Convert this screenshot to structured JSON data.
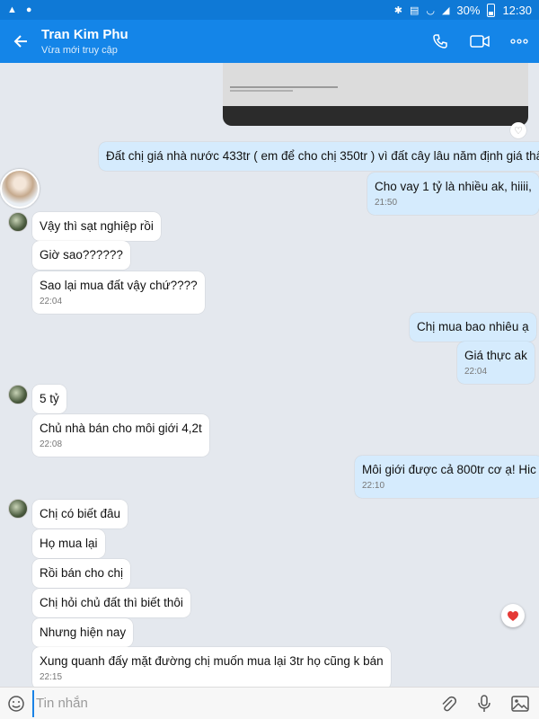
{
  "status_bar": {
    "battery": "30%",
    "time": "12:30"
  },
  "header": {
    "name": "Tran Kim Phu",
    "status": "Vừa mới truy cập"
  },
  "messages": [
    {
      "text": "Đất chị giá nhà nước 433tr  ( em để cho chị 350tr )  vì đất cây lâu năm định giá thấp"
    },
    {
      "text": "Cho vay 1 tỷ là nhiều ak,  hiiii,",
      "time": "21:50"
    },
    {
      "text": "Vậy thì sạt nghiệp rồi"
    },
    {
      "text": "Giờ sao??????"
    },
    {
      "text": "Sao lại mua đất vậy chứ????",
      "time": "22:04"
    },
    {
      "text": "Chị mua bao nhiêu ạ"
    },
    {
      "text": "Giá thực ak",
      "time": "22:04"
    },
    {
      "text": "5 tỷ"
    },
    {
      "text": "Chủ nhà bán cho môi giới 4,2t",
      "time": "22:08"
    },
    {
      "text": "Môi giới được cả 800tr cơ ạ!  Hic",
      "time": "22:10"
    },
    {
      "text": "Chị có biết đâu"
    },
    {
      "text": "Họ mua lại"
    },
    {
      "text": "Rồi bán cho chị"
    },
    {
      "text": "Chị hỏi chủ đất thì biết thôi"
    },
    {
      "text": "Nhưng hiện nay"
    },
    {
      "text": "Xung quanh đấy mặt đường chị muốn mua lại 3tr họ cũng k bán",
      "time": "22:15"
    }
  ],
  "input": {
    "placeholder": "Tin nhắn"
  },
  "colors": {
    "header": "#1485e8",
    "status_bar": "#0f79d6",
    "outgoing_bubble": "#d5ebfd",
    "incoming_bubble": "#ffffff",
    "background": "#e4e8ee"
  },
  "icons": [
    "back-arrow",
    "phone",
    "video-camera",
    "more-dots",
    "heart",
    "emoji",
    "paperclip",
    "microphone",
    "image"
  ]
}
